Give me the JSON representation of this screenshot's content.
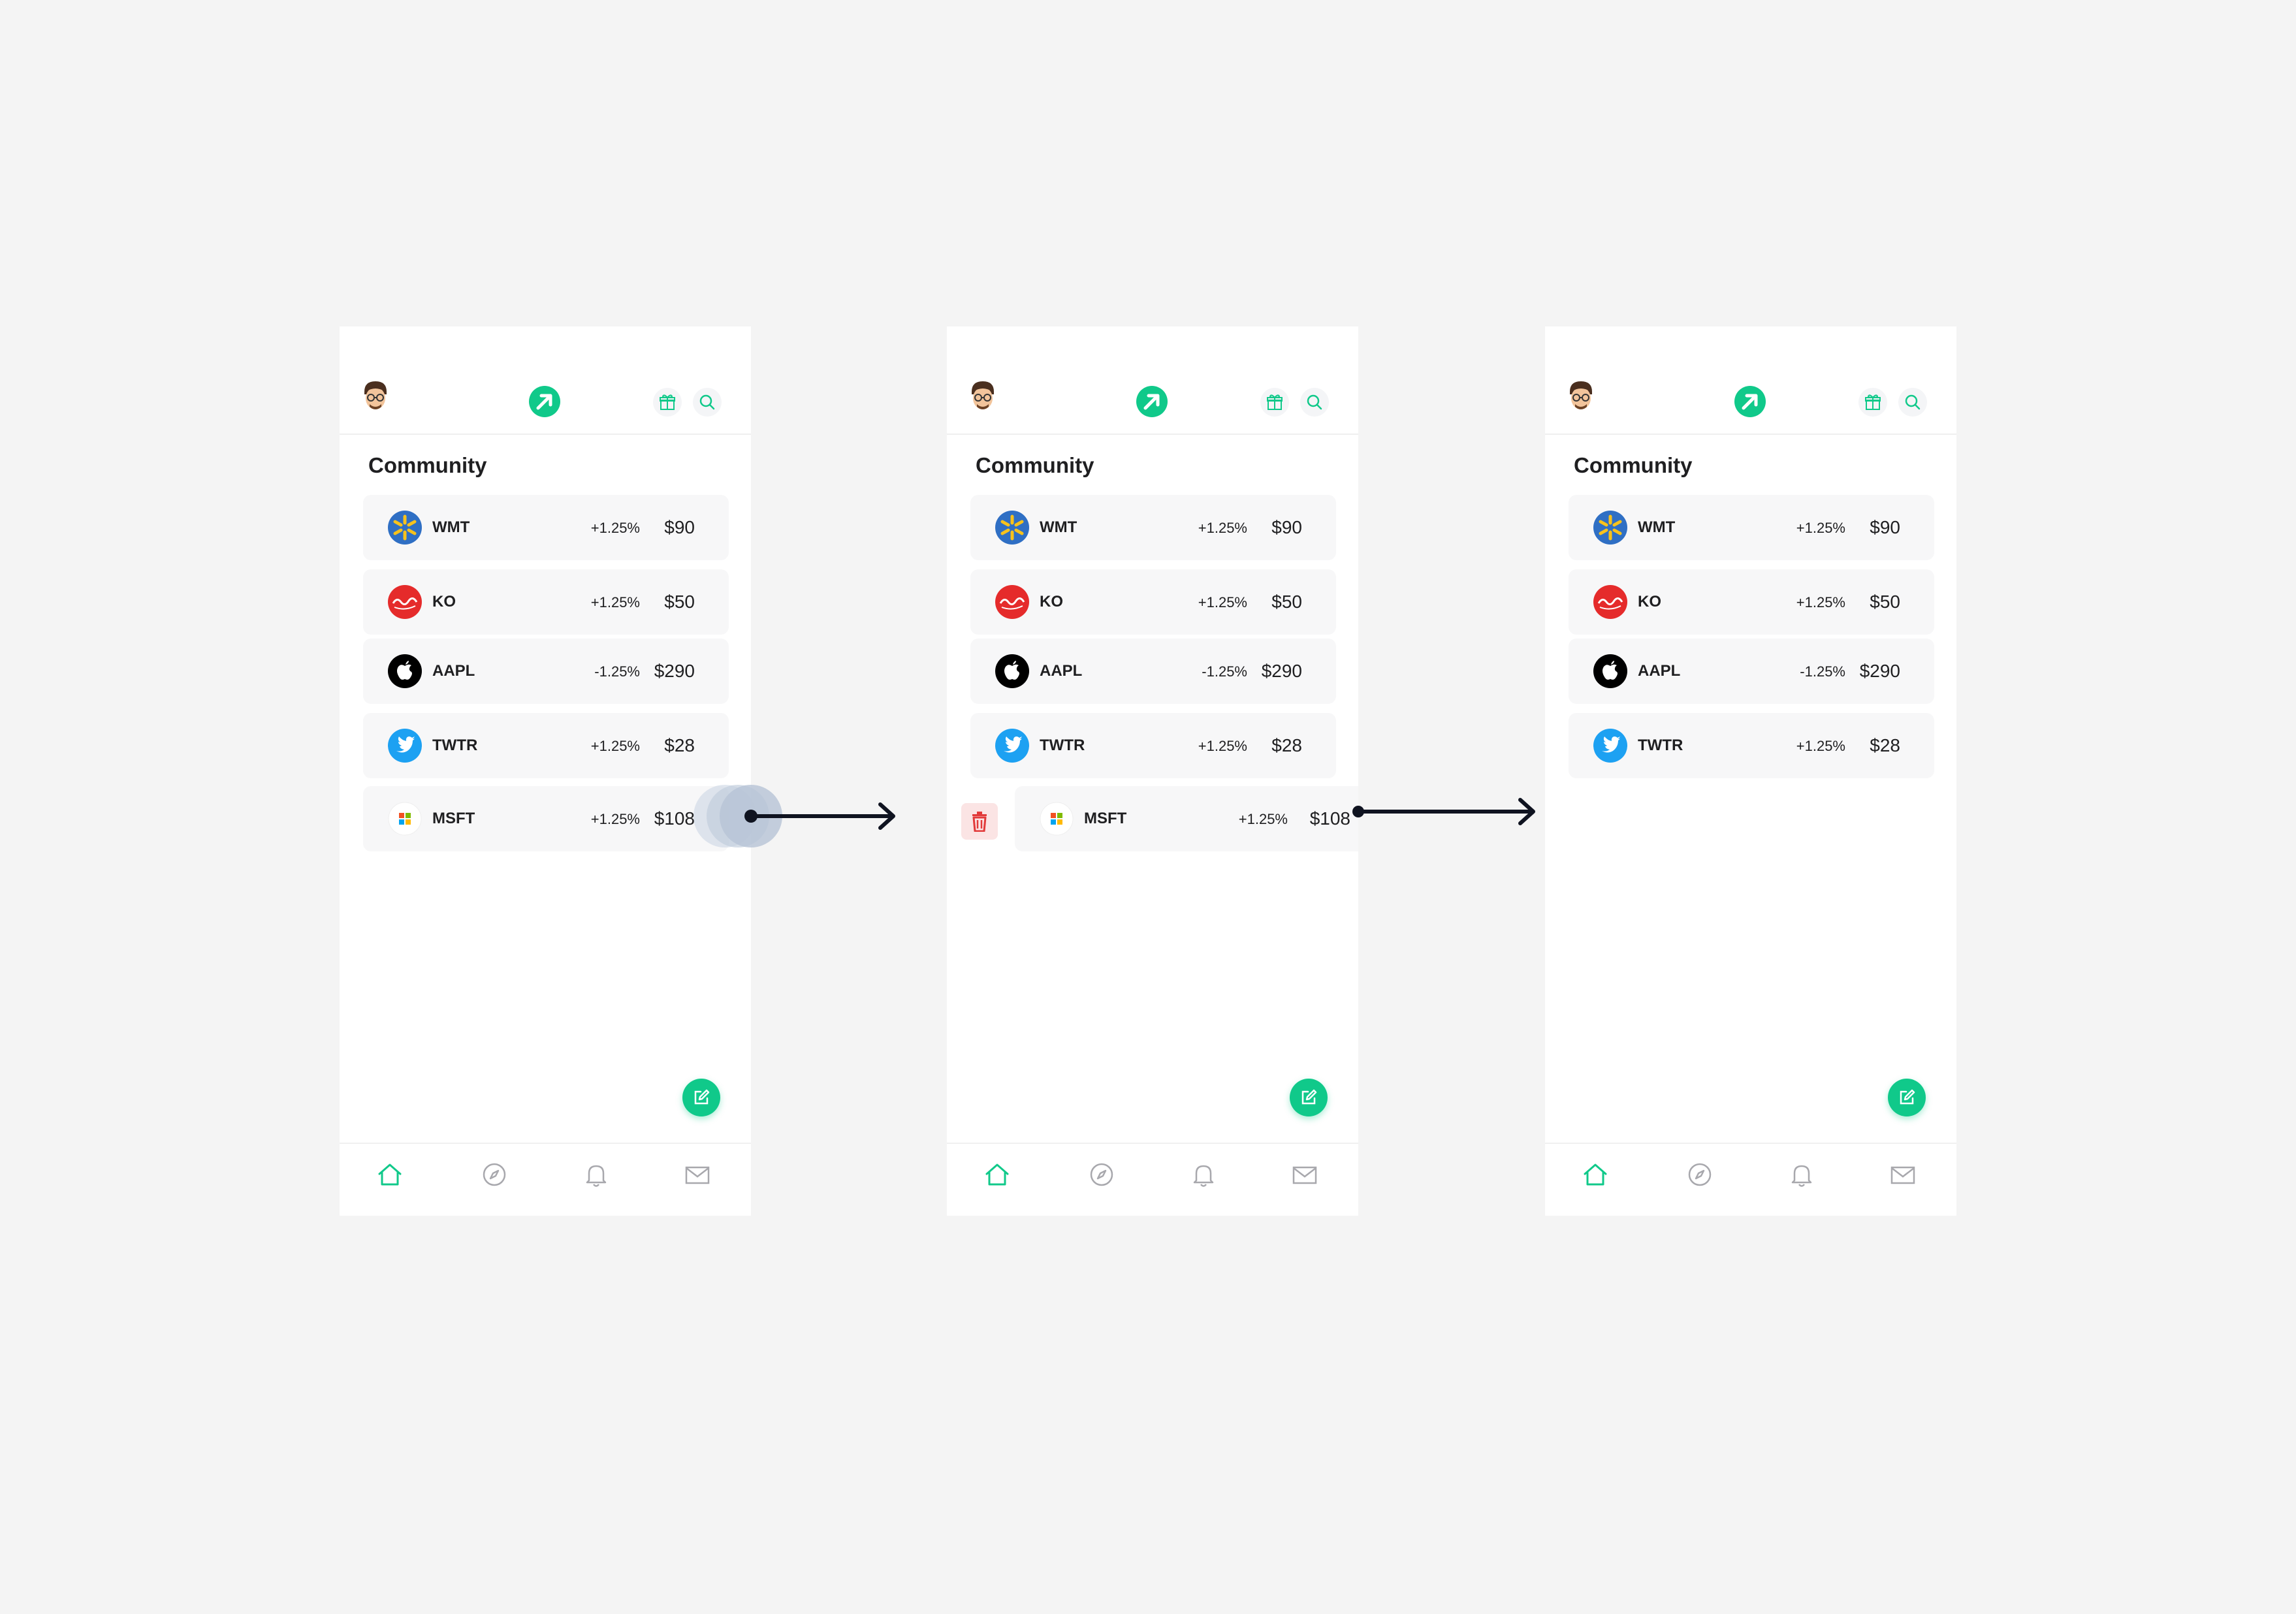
{
  "screens": [
    {
      "section_title": "Community",
      "stocks": [
        {
          "symbol": "WMT",
          "change": "+1.25%",
          "price": "$90"
        },
        {
          "symbol": "KO",
          "change": "+1.25%",
          "price": "$50"
        },
        {
          "symbol": "AAPL",
          "change": "-1.25%",
          "price": "$290"
        },
        {
          "symbol": "TWTR",
          "change": "+1.25%",
          "price": "$28"
        },
        {
          "symbol": "MSFT",
          "change": "+1.25%",
          "price": "$108"
        }
      ]
    },
    {
      "section_title": "Community",
      "stocks": [
        {
          "symbol": "WMT",
          "change": "+1.25%",
          "price": "$90"
        },
        {
          "symbol": "KO",
          "change": "+1.25%",
          "price": "$50"
        },
        {
          "symbol": "AAPL",
          "change": "-1.25%",
          "price": "$290"
        },
        {
          "symbol": "TWTR",
          "change": "+1.25%",
          "price": "$28"
        },
        {
          "symbol": "MSFT",
          "change": "+1.25%",
          "price": "$108"
        }
      ]
    },
    {
      "section_title": "Community",
      "stocks": [
        {
          "symbol": "WMT",
          "change": "+1.25%",
          "price": "$90"
        },
        {
          "symbol": "KO",
          "change": "+1.25%",
          "price": "$50"
        },
        {
          "symbol": "AAPL",
          "change": "-1.25%",
          "price": "$290"
        },
        {
          "symbol": "TWTR",
          "change": "+1.25%",
          "price": "$28"
        }
      ]
    }
  ],
  "icons": {
    "header": [
      "avatar",
      "app-logo-icon",
      "gift-icon",
      "search-icon"
    ],
    "nav": [
      "home-icon",
      "compass-icon",
      "bell-icon",
      "mail-icon"
    ],
    "compose": "compose-icon",
    "delete": "trash-icon"
  },
  "colors": {
    "accent": "#10c98a",
    "delete": "#e23a3a",
    "delete_bg": "#fbe4e4",
    "background": "#f4f4f4",
    "row_bg": "#f7f7f8",
    "swipe_touch": "#c9d4e2",
    "arrow": "#0f1320"
  }
}
